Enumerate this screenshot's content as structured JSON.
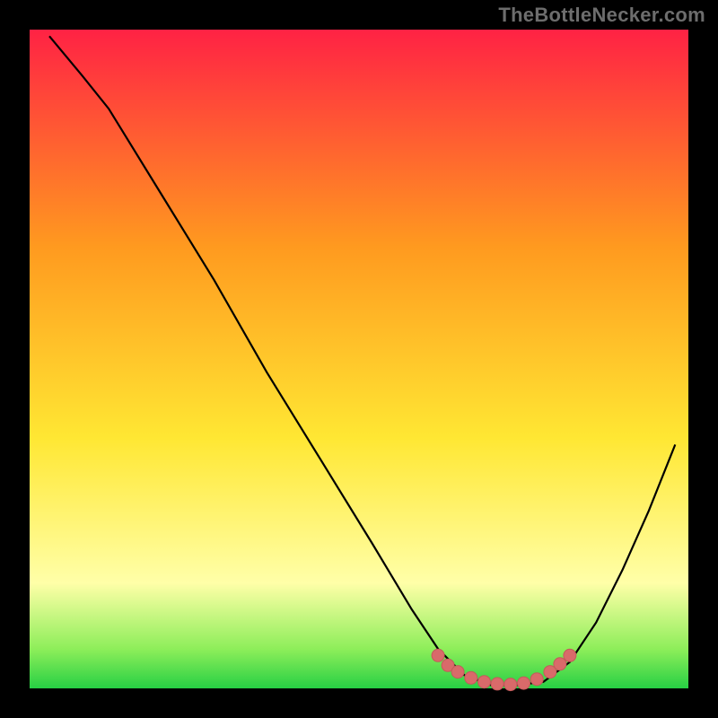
{
  "watermark": "TheBottleNecker.com",
  "colors": {
    "top_red": "#ff2244",
    "mid_orange": "#ff9a1f",
    "yellow": "#ffe733",
    "pale_yellow": "#ffffa8",
    "green_light": "#8eee5a",
    "green": "#27d044",
    "curve_stroke": "#000000",
    "marker_fill": "#d96a6a",
    "marker_stroke": "#c45a5a",
    "frame_black": "#000000"
  },
  "chart_data": {
    "type": "line",
    "title": "",
    "xlabel": "",
    "ylabel": "",
    "xlim": [
      0,
      100
    ],
    "ylim": [
      0,
      100
    ],
    "note": "Axes have no labeled ticks in the image; x/y values below are estimated relative positions (0–100) of the plotted black curve, read from the pixels.",
    "series": [
      {
        "name": "bottleneck-curve",
        "points": [
          {
            "x": 3,
            "y": 99
          },
          {
            "x": 8,
            "y": 93
          },
          {
            "x": 12,
            "y": 88
          },
          {
            "x": 20,
            "y": 75
          },
          {
            "x": 28,
            "y": 62
          },
          {
            "x": 36,
            "y": 48
          },
          {
            "x": 44,
            "y": 35
          },
          {
            "x": 52,
            "y": 22
          },
          {
            "x": 58,
            "y": 12
          },
          {
            "x": 62,
            "y": 6
          },
          {
            "x": 66,
            "y": 2
          },
          {
            "x": 70,
            "y": 0.5
          },
          {
            "x": 74,
            "y": 0.5
          },
          {
            "x": 78,
            "y": 1
          },
          {
            "x": 82,
            "y": 4
          },
          {
            "x": 86,
            "y": 10
          },
          {
            "x": 90,
            "y": 18
          },
          {
            "x": 94,
            "y": 27
          },
          {
            "x": 98,
            "y": 37
          }
        ]
      }
    ],
    "markers": {
      "name": "highlighted-range",
      "points": [
        {
          "x": 62,
          "y": 5
        },
        {
          "x": 63.5,
          "y": 3.5
        },
        {
          "x": 65,
          "y": 2.5
        },
        {
          "x": 67,
          "y": 1.6
        },
        {
          "x": 69,
          "y": 1.0
        },
        {
          "x": 71,
          "y": 0.7
        },
        {
          "x": 73,
          "y": 0.6
        },
        {
          "x": 75,
          "y": 0.8
        },
        {
          "x": 77,
          "y": 1.4
        },
        {
          "x": 79,
          "y": 2.5
        },
        {
          "x": 80.5,
          "y": 3.7
        },
        {
          "x": 82,
          "y": 5
        }
      ]
    }
  }
}
